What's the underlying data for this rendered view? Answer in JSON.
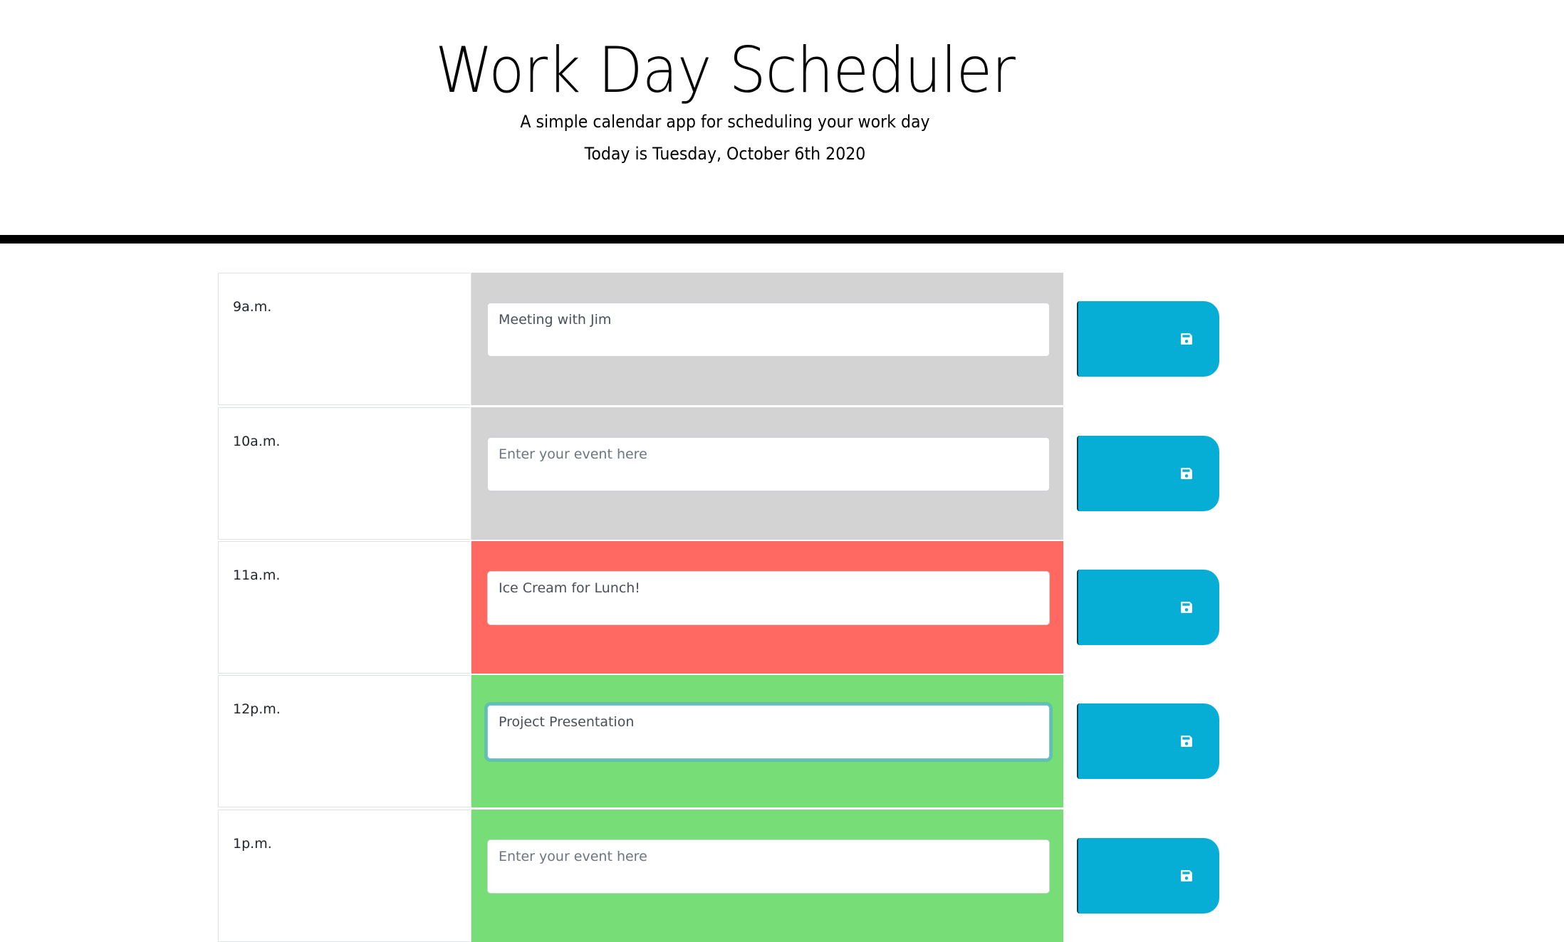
{
  "header": {
    "title": "Work Day Scheduler",
    "subtitle": "A simple calendar app for scheduling your work day",
    "today": "Today is Tuesday, October 6th 2020"
  },
  "colors": {
    "past": "#d3d3d3",
    "present": "#ff6961",
    "future": "#77dd77",
    "save_button": "#06aed5"
  },
  "schedule": {
    "placeholder": "Enter your event here",
    "save_icon": "floppy-disk-icon",
    "rows": [
      {
        "hour": "9a.m.",
        "status": "past",
        "value": "Meeting with Jim"
      },
      {
        "hour": "10a.m.",
        "status": "past",
        "value": ""
      },
      {
        "hour": "11a.m.",
        "status": "present",
        "value": "Ice Cream for Lunch!"
      },
      {
        "hour": "12p.m.",
        "status": "future",
        "value": "Project Presentation",
        "focused": true
      },
      {
        "hour": "1p.m.",
        "status": "future",
        "value": ""
      }
    ]
  }
}
